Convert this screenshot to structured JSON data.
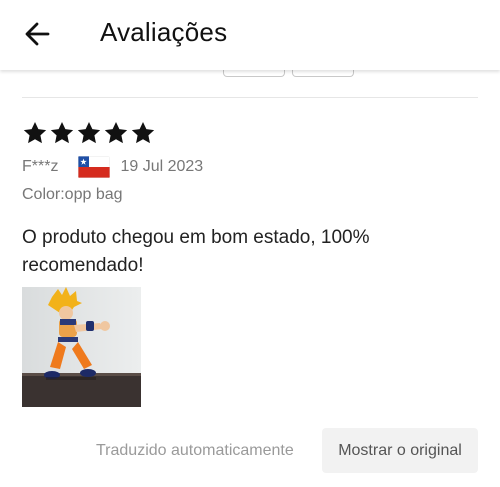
{
  "header": {
    "title": "Avaliações",
    "back_icon": "arrow-left-icon"
  },
  "review": {
    "rating": 5,
    "max_rating": 5,
    "reviewer": "F***z",
    "country_flag": "chile-flag-icon",
    "date": "19 Jul 2023",
    "variant": "Color:opp bag",
    "text": "O produto chegou em bom estado, 100% recomendado!",
    "translated_label": "Traduzido automaticamente",
    "show_original_label": "Mostrar o original"
  },
  "colors": {
    "star": "#111111",
    "flag_blue": "#1f4fa6",
    "flag_red": "#d52b1e",
    "muted_text": "#777777",
    "button_bg": "#f2f2f2"
  }
}
